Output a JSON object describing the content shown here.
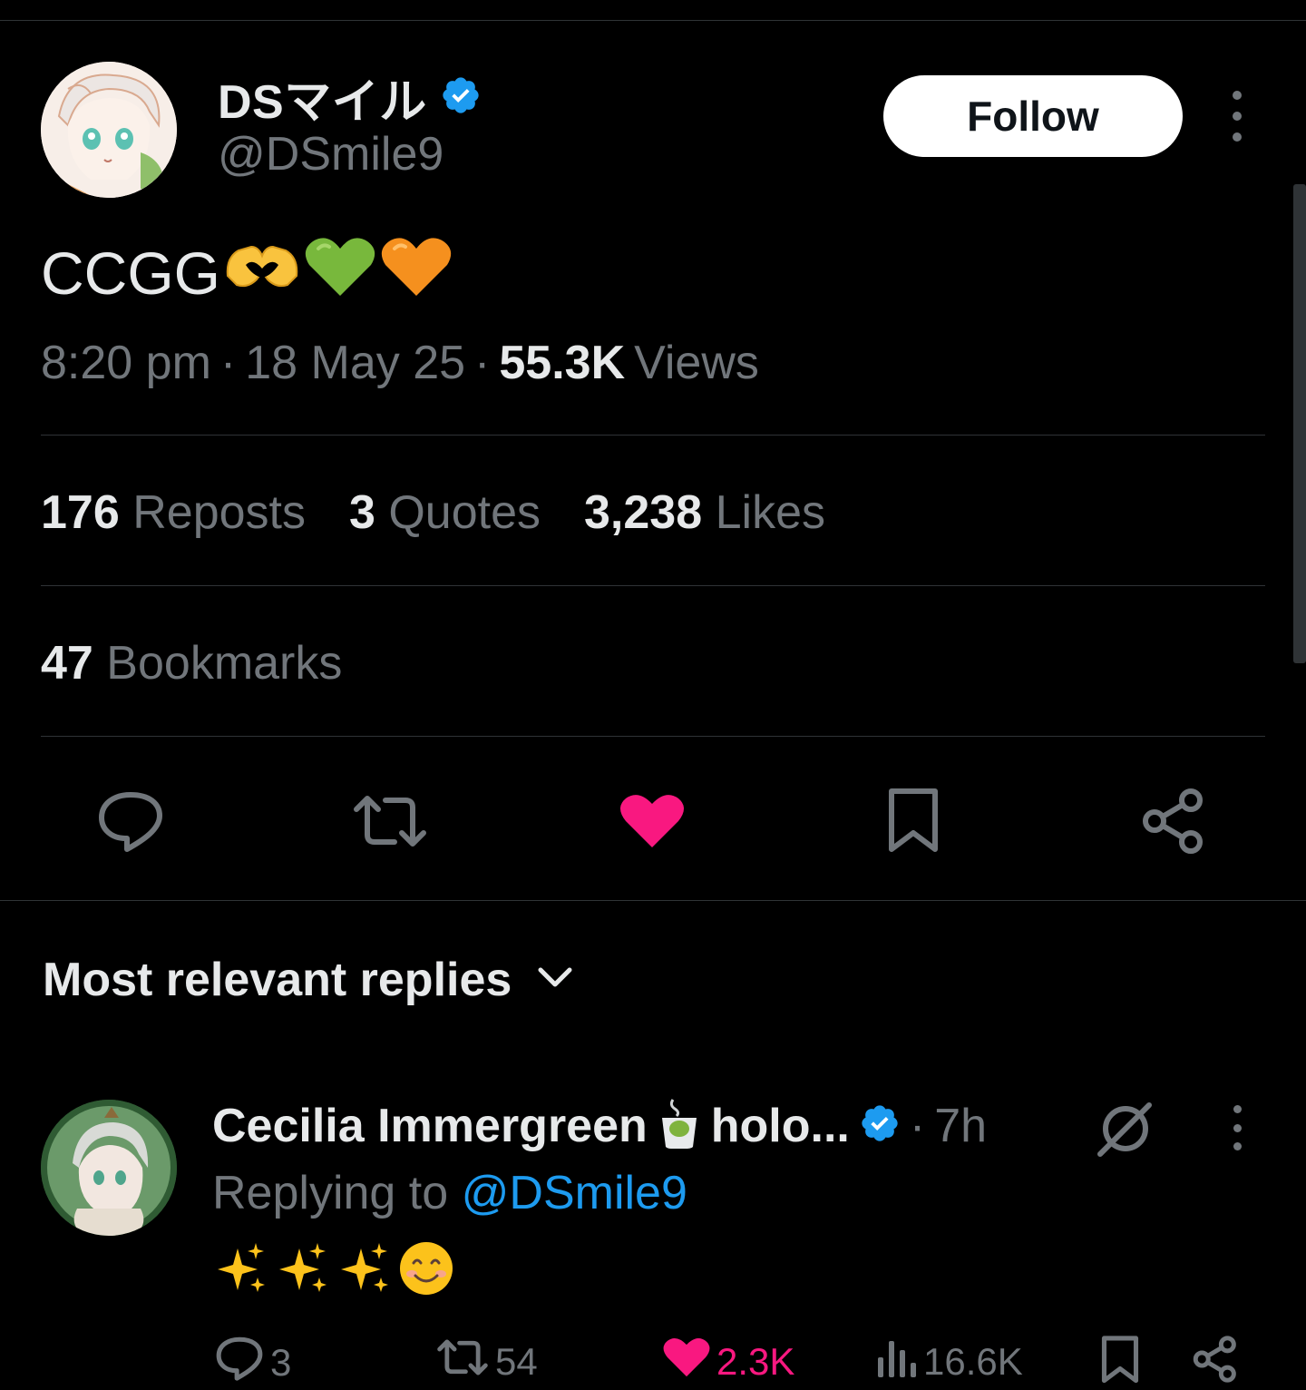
{
  "tweet": {
    "display_name": "DSマイル",
    "handle": "@DSmile9",
    "follow_label": "Follow",
    "text": "CCGG",
    "time": "8:20 pm",
    "separator": "·",
    "date": "18 May 25",
    "views_count": "55.3K",
    "views_label": "Views"
  },
  "stats": {
    "reposts_count": "176",
    "reposts_label": "Reposts",
    "quotes_count": "3",
    "quotes_label": "Quotes",
    "likes_count": "3,238",
    "likes_label": "Likes",
    "bookmarks_count": "47",
    "bookmarks_label": "Bookmarks"
  },
  "colors": {
    "background": "#000000",
    "text_primary": "#e7e9ea",
    "text_secondary": "#71767b",
    "accent_blue": "#1d9bf0",
    "like_pink": "#f91880",
    "verified_blue": "#1d9bf0"
  },
  "replies": {
    "header": "Most relevant replies",
    "items": [
      {
        "name_part1": "Cecilia Immergreen",
        "name_part2": "holo...",
        "time": "7h",
        "replying_to_label": "Replying to",
        "replying_to_handle": "@DSmile9",
        "reply_count": "3",
        "repost_count": "54",
        "like_count": "2.3K",
        "view_count": "16.6K"
      }
    ]
  },
  "icons": {
    "tweet_emojis": [
      "heart-hands-icon",
      "green-heart-icon",
      "orange-heart-icon"
    ],
    "reply_emojis": [
      "sparkles-icon",
      "sparkles-icon",
      "sparkles-icon",
      "smiling-face-icon"
    ]
  }
}
